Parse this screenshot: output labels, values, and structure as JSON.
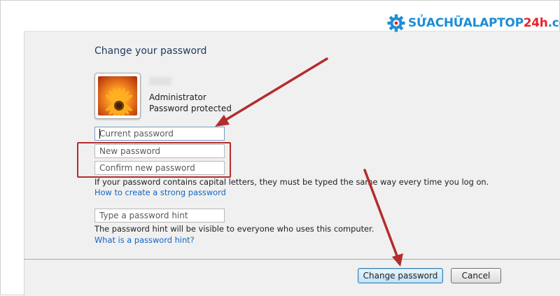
{
  "watermark": {
    "part_a": "SỬA",
    "part_b": "CHỮALAPTOP",
    "part_c": "24h",
    "part_d": ".com",
    "icon": "gear-icon",
    "colors": {
      "blue": "#1c8ed6",
      "red": "#e8232b"
    }
  },
  "dialog": {
    "title": "Change your password",
    "account": {
      "name": "Administrator",
      "status": "Password protected",
      "avatar_icon": "flower-avatar"
    },
    "fields": {
      "current_password": "Current password",
      "new_password": "New password",
      "confirm_password": "Confirm new password",
      "hint": "Type a password hint"
    },
    "notes": {
      "capital_letters": "If your password contains capital letters, they must be typed the same way every time you log on.",
      "hint_visibility": "The password hint will be visible to everyone who uses this computer."
    },
    "links": {
      "strong_password": "How to create a strong password",
      "what_is_hint": "What is a password hint?"
    },
    "buttons": {
      "change": "Change password",
      "cancel": "Cancel"
    }
  },
  "annotations": {
    "color": "#b32d2d",
    "arrow_count": 2
  }
}
